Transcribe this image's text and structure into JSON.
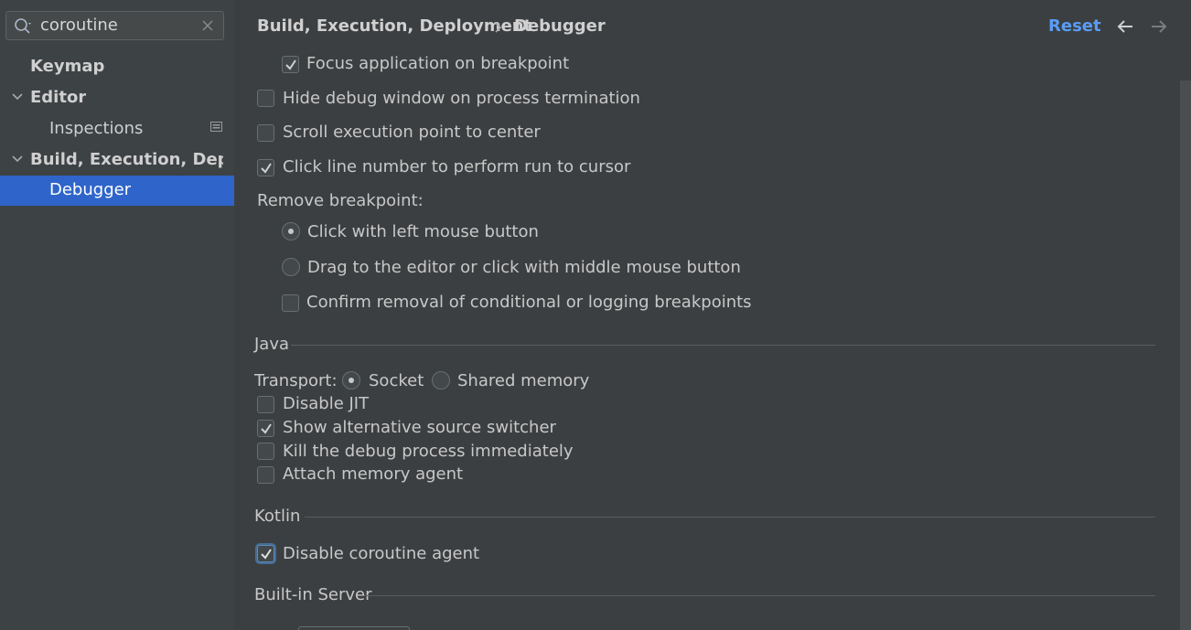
{
  "search": {
    "value": "coroutine"
  },
  "sidebar": {
    "items": [
      {
        "label": "Keymap"
      },
      {
        "label": "Editor"
      },
      {
        "label": "Inspections"
      },
      {
        "label": "Build, Execution, Deployment"
      },
      {
        "label": "Debugger"
      }
    ]
  },
  "header": {
    "breadcrumb_parent": "Build, Execution, Deployment",
    "breadcrumb_current": "Debugger",
    "reset_label": "Reset"
  },
  "general": {
    "focus_app": {
      "label": "Focus application on breakpoint",
      "checked": true
    },
    "hide_debug_window": {
      "label": "Hide debug window on process termination",
      "checked": false
    },
    "scroll_center": {
      "label": "Scroll execution point to center",
      "checked": false
    },
    "click_line_number": {
      "label": "Click line number to perform run to cursor",
      "checked": true
    },
    "remove_breakpoint_label": "Remove breakpoint:",
    "remove_options": [
      {
        "label": "Click with left mouse button",
        "selected": true
      },
      {
        "label": "Drag to the editor or click with middle mouse button",
        "selected": false
      }
    ],
    "confirm_removal": {
      "label": "Confirm removal of conditional or logging breakpoints",
      "checked": false
    }
  },
  "java": {
    "title": "Java",
    "transport_label": "Transport:",
    "transport_options": [
      {
        "label": "Socket",
        "selected": true
      },
      {
        "label": "Shared memory",
        "selected": false
      }
    ],
    "disable_jit": {
      "label": "Disable JIT",
      "checked": false
    },
    "alt_source": {
      "label": "Show alternative source switcher",
      "checked": true
    },
    "kill_process": {
      "label": "Kill the debug process immediately",
      "checked": false
    },
    "memory_agent": {
      "label": "Attach memory agent",
      "checked": false
    }
  },
  "kotlin": {
    "title": "Kotlin",
    "disable_coroutine": {
      "label": "Disable coroutine agent",
      "checked": true
    }
  },
  "builtin": {
    "title": "Built-in Server"
  },
  "colors": {
    "accent": "#589df6",
    "selection": "#2f65ca",
    "background": "#3c3f41"
  }
}
